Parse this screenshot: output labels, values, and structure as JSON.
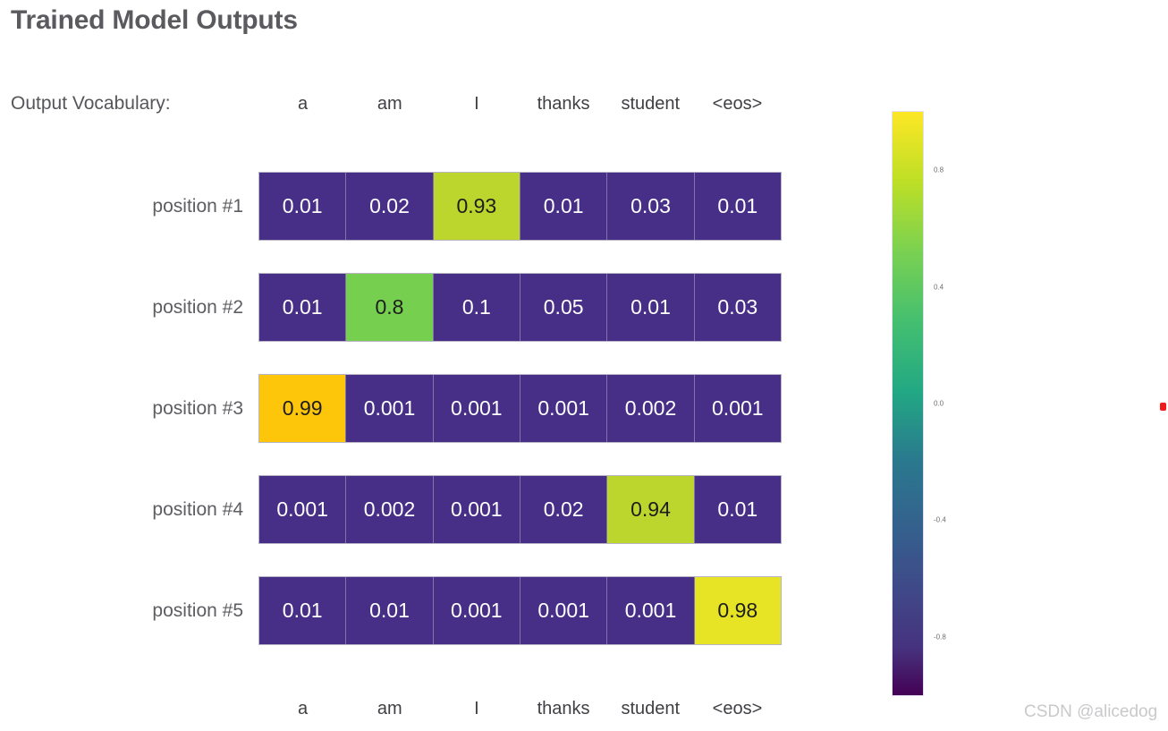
{
  "title": "Trained Model Outputs",
  "vocab_label": "Output Vocabulary:",
  "watermark": "CSDN @alicedog",
  "colors": {
    "dark_purple": "#472f87",
    "yellow_green": "#bcd62d",
    "green": "#76cf4e",
    "amber": "#fdc60b",
    "yellow": "#e6e424",
    "title_gray": "#5a5a5f",
    "label_gray": "#5d5d62",
    "watermark_gray": "#c9c9cc",
    "red_marker": "#ef1b1b"
  },
  "chart_data": {
    "type": "heatmap",
    "title": "Trained Model Outputs",
    "xlabel": "Output Vocabulary:",
    "ylabel": "",
    "categories": [
      "a",
      "am",
      "I",
      "thanks",
      "student",
      "<eos>"
    ],
    "rows": [
      "position #1",
      "position #2",
      "position #3",
      "position #4",
      "position #5"
    ],
    "colormap": "viridis",
    "colorbar": {
      "ticks": [
        "0.8",
        "0.4",
        "0.0",
        "-0.4",
        "-0.8"
      ],
      "tick_positions_pct": [
        10,
        30,
        50,
        70,
        90
      ],
      "range": [
        -1.0,
        1.0
      ],
      "position": "right"
    },
    "values": [
      [
        0.01,
        0.02,
        0.93,
        0.01,
        0.03,
        0.01
      ],
      [
        0.01,
        0.8,
        0.1,
        0.05,
        0.01,
        0.03
      ],
      [
        0.99,
        0.001,
        0.001,
        0.001,
        0.002,
        0.001
      ],
      [
        0.001,
        0.002,
        0.001,
        0.02,
        0.94,
        0.01
      ],
      [
        0.01,
        0.01,
        0.001,
        0.001,
        0.001,
        0.98
      ]
    ],
    "cells": [
      {
        "row_label": "position #1",
        "cells": [
          {
            "text": "0.01",
            "bg": "#472f87",
            "tone": "dark"
          },
          {
            "text": "0.02",
            "bg": "#472f87",
            "tone": "dark"
          },
          {
            "text": "0.93",
            "bg": "#bcd62d",
            "tone": "light"
          },
          {
            "text": "0.01",
            "bg": "#472f87",
            "tone": "dark"
          },
          {
            "text": "0.03",
            "bg": "#472f87",
            "tone": "dark"
          },
          {
            "text": "0.01",
            "bg": "#472f87",
            "tone": "dark"
          }
        ]
      },
      {
        "row_label": "position #2",
        "cells": [
          {
            "text": "0.01",
            "bg": "#472f87",
            "tone": "dark"
          },
          {
            "text": "0.8",
            "bg": "#76cf4e",
            "tone": "light"
          },
          {
            "text": "0.1",
            "bg": "#472f87",
            "tone": "dark"
          },
          {
            "text": "0.05",
            "bg": "#472f87",
            "tone": "dark"
          },
          {
            "text": "0.01",
            "bg": "#472f87",
            "tone": "dark"
          },
          {
            "text": "0.03",
            "bg": "#472f87",
            "tone": "dark"
          }
        ]
      },
      {
        "row_label": "position #3",
        "cells": [
          {
            "text": "0.99",
            "bg": "#fdc60b",
            "tone": "light"
          },
          {
            "text": "0.001",
            "bg": "#472f87",
            "tone": "dark"
          },
          {
            "text": "0.001",
            "bg": "#472f87",
            "tone": "dark"
          },
          {
            "text": "0.001",
            "bg": "#472f87",
            "tone": "dark"
          },
          {
            "text": "0.002",
            "bg": "#472f87",
            "tone": "dark"
          },
          {
            "text": "0.001",
            "bg": "#472f87",
            "tone": "dark"
          }
        ]
      },
      {
        "row_label": "position #4",
        "cells": [
          {
            "text": "0.001",
            "bg": "#472f87",
            "tone": "dark"
          },
          {
            "text": "0.002",
            "bg": "#472f87",
            "tone": "dark"
          },
          {
            "text": "0.001",
            "bg": "#472f87",
            "tone": "dark"
          },
          {
            "text": "0.02",
            "bg": "#472f87",
            "tone": "dark"
          },
          {
            "text": "0.94",
            "bg": "#bcd62d",
            "tone": "light"
          },
          {
            "text": "0.01",
            "bg": "#472f87",
            "tone": "dark"
          }
        ]
      },
      {
        "row_label": "position #5",
        "cells": [
          {
            "text": "0.01",
            "bg": "#472f87",
            "tone": "dark"
          },
          {
            "text": "0.01",
            "bg": "#472f87",
            "tone": "dark"
          },
          {
            "text": "0.001",
            "bg": "#472f87",
            "tone": "dark"
          },
          {
            "text": "0.001",
            "bg": "#472f87",
            "tone": "dark"
          },
          {
            "text": "0.001",
            "bg": "#472f87",
            "tone": "dark"
          },
          {
            "text": "0.98",
            "bg": "#e6e424",
            "tone": "light"
          }
        ]
      }
    ]
  }
}
